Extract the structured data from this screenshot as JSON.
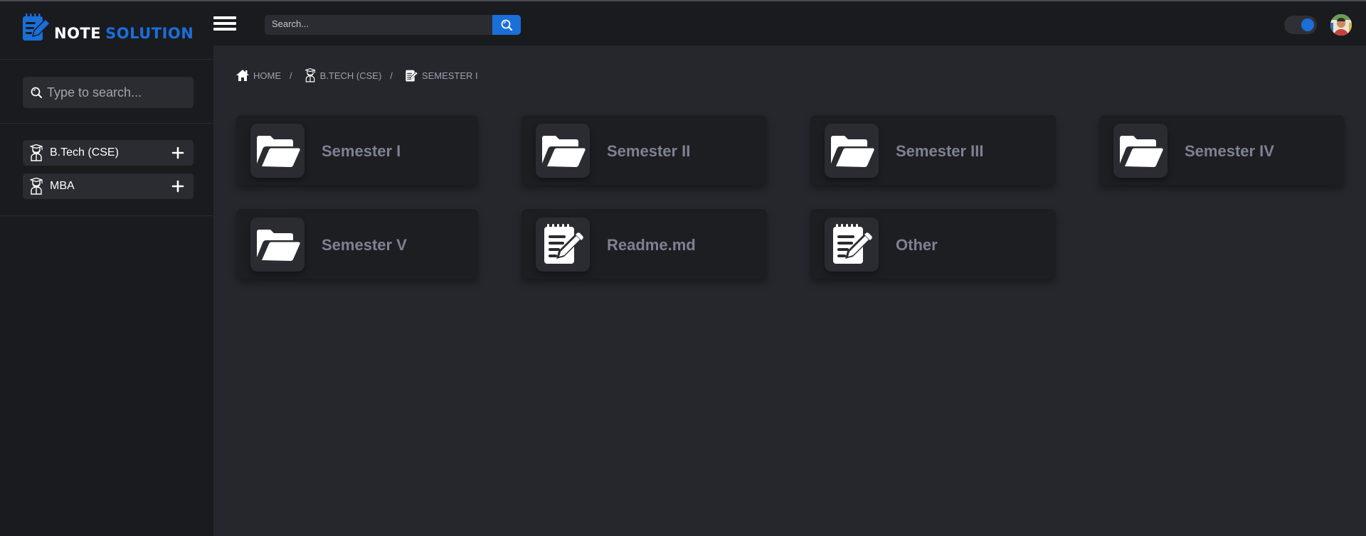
{
  "app": {
    "logo_word1": "NOTE",
    "logo_word2": "SOLUTION"
  },
  "header": {
    "search_placeholder": "Search..."
  },
  "sidebar": {
    "search_placeholder": "Type to search...",
    "items": [
      {
        "label": "B.Tech (CSE)"
      },
      {
        "label": "MBA"
      }
    ]
  },
  "breadcrumb": [
    {
      "label": "HOME",
      "icon": "home-icon"
    },
    {
      "label": "B.TECH (CSE)",
      "icon": "graduate-icon"
    },
    {
      "label": "SEMESTER I",
      "icon": "note-edit-icon"
    }
  ],
  "cards": [
    {
      "title": "Semester I",
      "icon": "folder-open-icon"
    },
    {
      "title": "Semester II",
      "icon": "folder-open-icon"
    },
    {
      "title": "Semester III",
      "icon": "folder-open-icon"
    },
    {
      "title": "Semester IV",
      "icon": "folder-open-icon"
    },
    {
      "title": "Semester V",
      "icon": "folder-open-icon"
    },
    {
      "title": "Readme.md",
      "icon": "notepad-icon"
    },
    {
      "title": "Other",
      "icon": "notepad-icon"
    }
  ],
  "colors": {
    "accent": "#1a6fd8",
    "panel": "#1a1b1f",
    "background": "#26272d",
    "card": "#1d1e22"
  }
}
